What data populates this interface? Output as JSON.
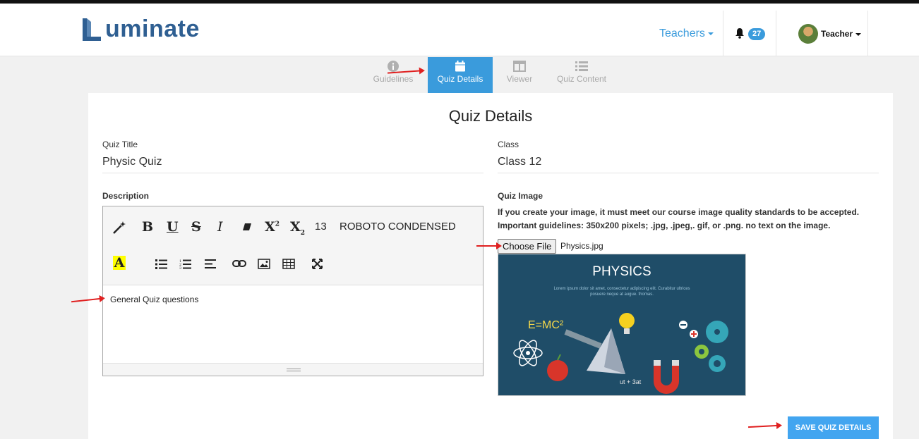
{
  "header": {
    "logo_text": "uminate",
    "nav_teachers": "Teachers",
    "notification_count": "27",
    "user_label": "Teacher"
  },
  "tabs": [
    {
      "label": "Guidelines",
      "icon": "info-icon"
    },
    {
      "label": "Quiz Details",
      "icon": "calendar-icon"
    },
    {
      "label": "Viewer",
      "icon": "columns-icon"
    },
    {
      "label": "Quiz Content",
      "icon": "list-icon"
    }
  ],
  "form": {
    "heading": "Quiz Details",
    "quiz_title_label": "Quiz Title",
    "quiz_title_value": "Physic Quiz",
    "class_label": "Class",
    "class_value": "Class 12",
    "description_label": "Description",
    "description_text": "General Quiz questions",
    "font_size": "13",
    "font_family": "ROBOTO CONDENSED",
    "quiz_image_label": "Quiz Image",
    "image_guidelines": "If you create your image, it must meet our course image quality standards to be accepted. Important guidelines: 350x200 pixels; .jpg, .jpeg,. gif, or .png. no text on the image.",
    "choose_file_label": "Choose File",
    "file_name": "Physics.jpg",
    "preview": {
      "title": "PHYSICS",
      "subtitle": "Lorem ipsum dolor sit amet, consectetur adipiscing elit. Curabitur ultrices posuere neque at augue. thomas.",
      "equation": "E=MC²",
      "formula": "ut + 3at"
    },
    "save_label": "SAVE QUIZ DETAILS"
  },
  "colors": {
    "accent": "#3a9bdc",
    "save_button": "#42a5f0",
    "logo": "#2f5f92",
    "annotation_arrow": "#e02020"
  }
}
